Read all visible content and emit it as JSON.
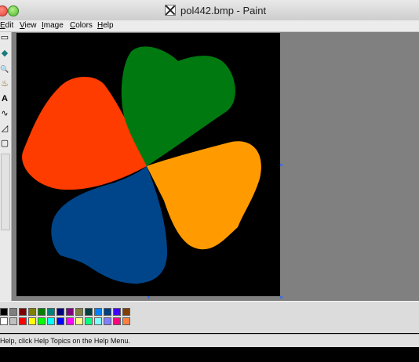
{
  "window": {
    "title": "pol442.bmp - Paint"
  },
  "menu": {
    "items": [
      "Edit",
      "View",
      "Image",
      "Colors",
      "Help"
    ]
  },
  "toolbox": {
    "tools": [
      {
        "name": "select-rect-tool",
        "glyph": "▭"
      },
      {
        "name": "fill-tool",
        "glyph": "◆"
      },
      {
        "name": "magnifier-tool",
        "glyph": "🔍"
      },
      {
        "name": "brush-tool",
        "glyph": "♨"
      },
      {
        "name": "text-tool",
        "glyph": "A"
      },
      {
        "name": "curve-tool",
        "glyph": "∿"
      },
      {
        "name": "polygon-tool",
        "glyph": "◿"
      },
      {
        "name": "rounded-rect-tool",
        "glyph": "▢"
      }
    ]
  },
  "canvas": {
    "background": "#000000",
    "petals": [
      {
        "name": "red-petal",
        "color": "#ff3c00"
      },
      {
        "name": "green-petal",
        "color": "#007a10"
      },
      {
        "name": "orange-petal",
        "color": "#ff9b00"
      },
      {
        "name": "blue-petal",
        "color": "#00458a"
      }
    ]
  },
  "palette": {
    "colors": [
      "#000000",
      "#7f7f7f",
      "#7f0000",
      "#7f7f00",
      "#007f00",
      "#007f7f",
      "#00007f",
      "#7f007f",
      "#7f7f3f",
      "#003f3f",
      "#007fff",
      "#003f7f",
      "#3f00ff",
      "#7f3f00",
      "#ffffff",
      "#bfbfbf",
      "#ff0000",
      "#ffff00",
      "#00ff00",
      "#00ffff",
      "#0000ff",
      "#ff00ff",
      "#ffff7f",
      "#00ff7f",
      "#7fffff",
      "#7f7fff",
      "#ff007f",
      "#ff7f3f"
    ]
  },
  "status": {
    "text": "For Help, click Help Topics on the Help Menu."
  }
}
